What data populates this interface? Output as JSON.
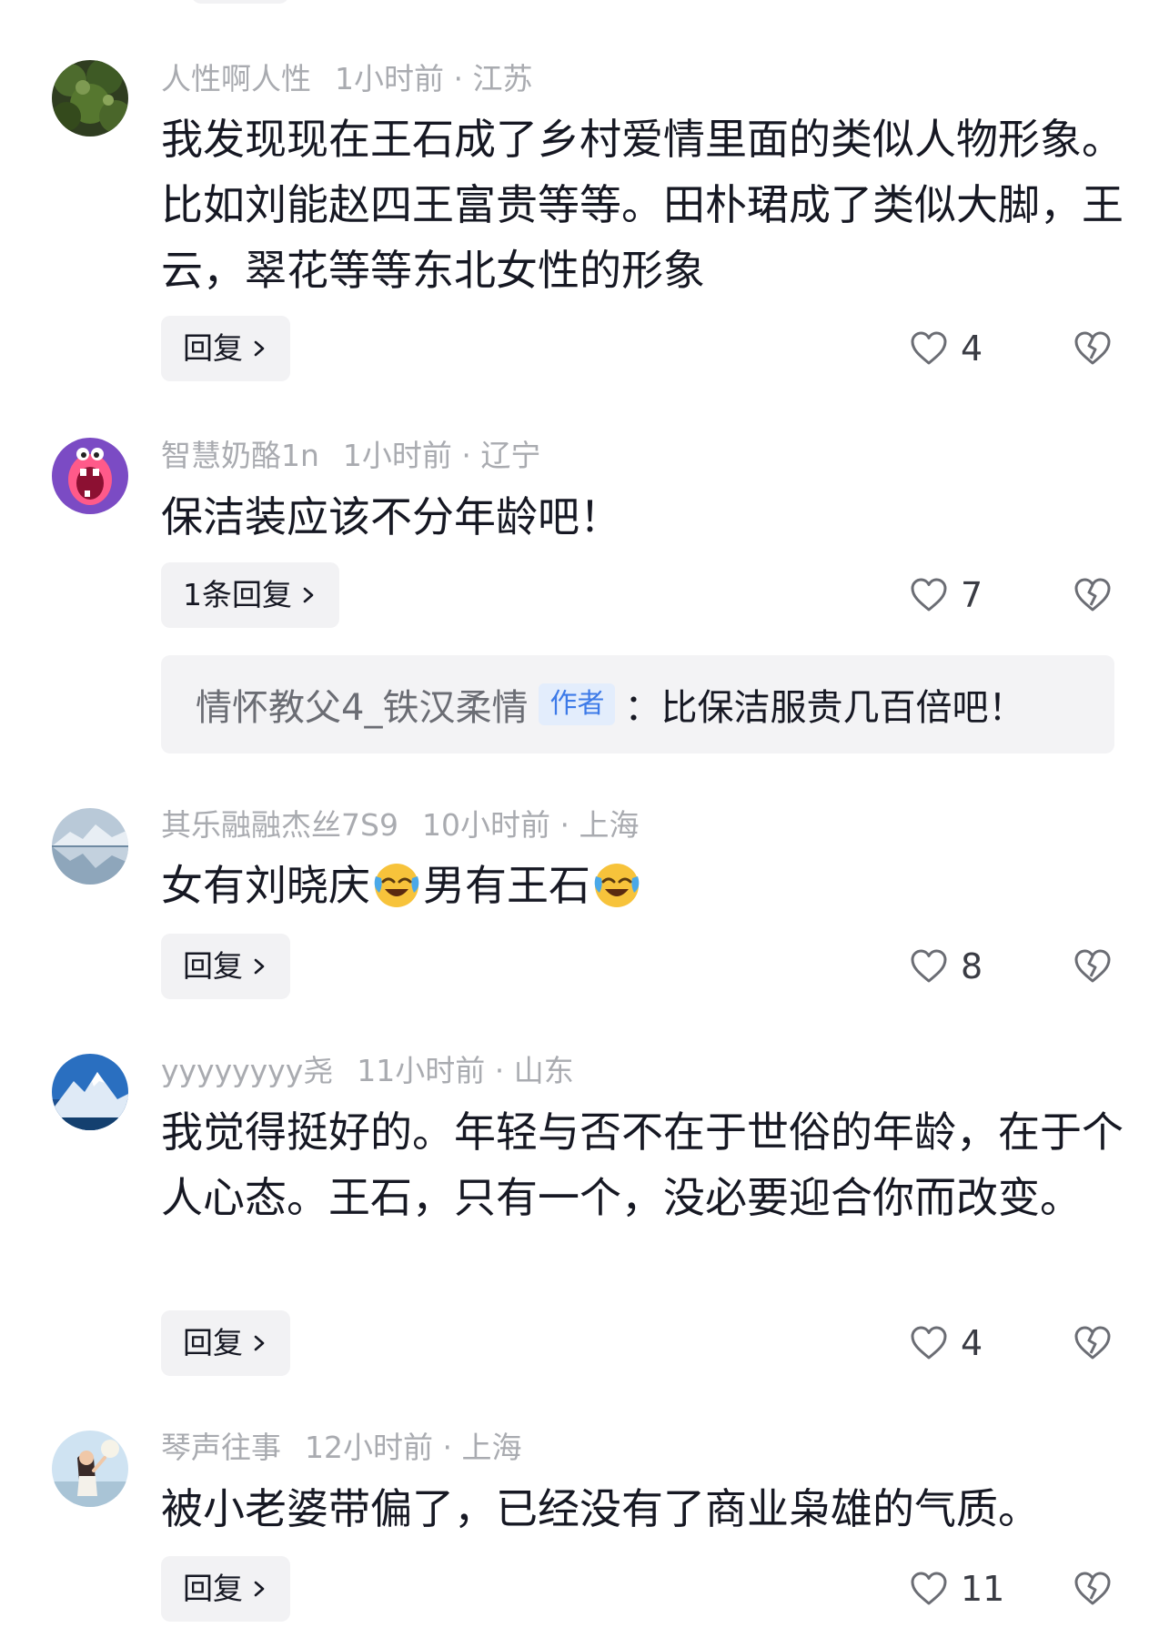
{
  "comments": [
    {
      "username": "人性啊人性",
      "time": "1小时前",
      "location": "江苏",
      "text": "我发现现在王石成了乡村爱情里面的类似人物形象。比如刘能赵四王富贵等等。田朴珺成了类似大脚，王云，翠花等等东北女性的形象",
      "reply_label": "回复",
      "likes": "4",
      "avatar_icon": "forest-avatar-icon"
    },
    {
      "username": "智慧奶酪1n",
      "time": "1小时前",
      "location": "辽宁",
      "text": "保洁装应该不分年龄吧！",
      "reply_label": "1条回复",
      "likes": "7",
      "avatar_icon": "cartoon-mouth-avatar-icon",
      "reply_preview": {
        "user": "情怀教父4_铁汉柔情",
        "badge": "作者",
        "text": "：比保洁服贵几百倍吧！"
      }
    },
    {
      "username": "其乐融融杰丝7S9",
      "time": "10小时前",
      "location": "上海",
      "text_before": "女有刘晓庆",
      "text_middle": "男有王石",
      "reply_label": "回复",
      "likes": "8",
      "avatar_icon": "mountain-lake-avatar-icon",
      "emoji_icon": "laughing-crying-emoji-icon"
    },
    {
      "username": "yyyyyyyy尧",
      "time": "11小时前",
      "location": "山东",
      "text": "我觉得挺好的。年轻与否不在于世俗的年龄，在于个人心态。王石，只有一个，没必要迎合你而改变。",
      "reply_label": "回复",
      "likes": "4",
      "avatar_icon": "snow-mountain-avatar-icon"
    },
    {
      "username": "琴声往事",
      "time": "12小时前",
      "location": "上海",
      "text": "被小老婆带偏了，已经没有了商业枭雄的气质。",
      "reply_label": "回复",
      "likes": "11",
      "avatar_icon": "girl-sky-avatar-icon"
    }
  ],
  "separator": "·",
  "colors": {
    "meta": "#a9abb0",
    "text": "#161823",
    "chip_bg": "#f2f2f4",
    "author_badge_bg": "#e3edfc",
    "author_badge_text": "#3d7ae8"
  }
}
